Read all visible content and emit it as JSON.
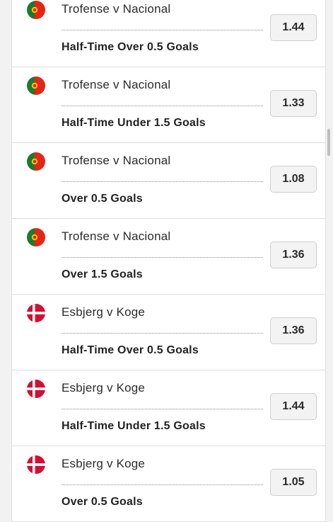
{
  "icons": {
    "portugal": "portugal-flag-icon",
    "denmark": "denmark-flag-icon"
  },
  "colors": {
    "portugal_green": "#1b7a2e",
    "portugal_red": "#e42518",
    "portugal_yellow": "#f5d000",
    "denmark_red": "#d21034",
    "odds_button_bg": "#f3f3f3"
  },
  "bets": [
    {
      "flag": "portugal",
      "match": "Trofense v Nacional",
      "market": "Half-Time Over 0.5 Goals",
      "odds": "1.44"
    },
    {
      "flag": "portugal",
      "match": "Trofense v Nacional",
      "market": "Half-Time Under 1.5 Goals",
      "odds": "1.33"
    },
    {
      "flag": "portugal",
      "match": "Trofense v Nacional",
      "market": "Over 0.5 Goals",
      "odds": "1.08"
    },
    {
      "flag": "portugal",
      "match": "Trofense v Nacional",
      "market": "Over 1.5 Goals",
      "odds": "1.36"
    },
    {
      "flag": "denmark",
      "match": "Esbjerg v Koge",
      "market": "Half-Time Over 0.5 Goals",
      "odds": "1.36"
    },
    {
      "flag": "denmark",
      "match": "Esbjerg v Koge",
      "market": "Half-Time Under 1.5 Goals",
      "odds": "1.44"
    },
    {
      "flag": "denmark",
      "match": "Esbjerg v Koge",
      "market": "Over 0.5 Goals",
      "odds": "1.05"
    }
  ]
}
